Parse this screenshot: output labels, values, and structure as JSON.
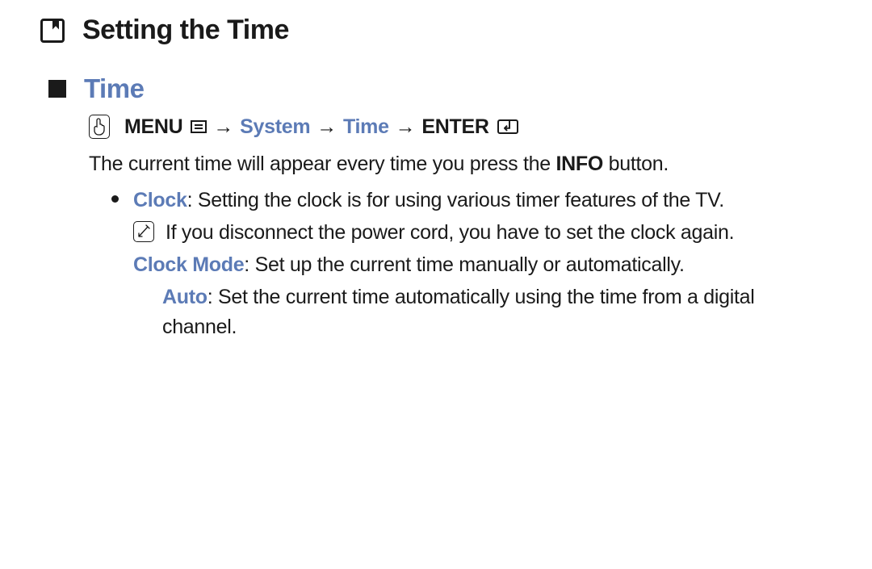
{
  "heading": "Setting the Time",
  "section": {
    "title": "Time",
    "nav": {
      "menu": "MENU",
      "crumb1": "System",
      "crumb2": "Time",
      "enter": "ENTER",
      "arrow": "→"
    },
    "intro_pre": "The current time will appear every time you press the ",
    "intro_bold": "INFO",
    "intro_post": " button.",
    "clock": {
      "term": "Clock",
      "desc": ": Setting the clock is for using various timer features of the TV.",
      "note": "If you disconnect the power cord, you have to set the clock again.",
      "mode_term": "Clock Mode",
      "mode_desc": ": Set up the current time manually or automatically.",
      "auto_term": "Auto",
      "auto_desc": ": Set the current time automatically using the time from a digital channel."
    }
  }
}
